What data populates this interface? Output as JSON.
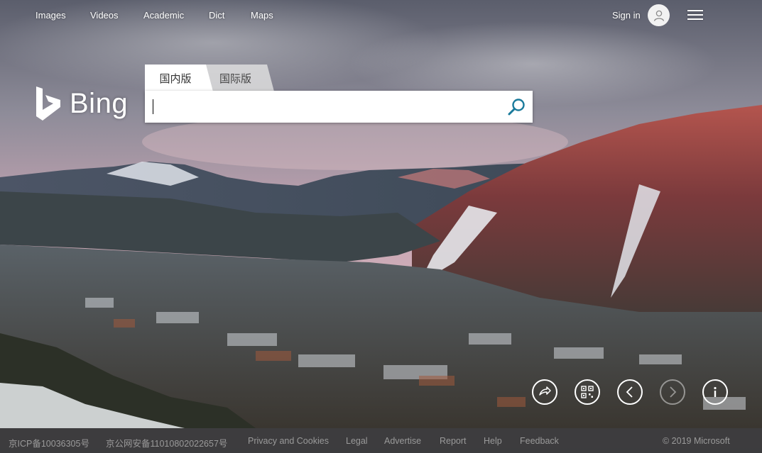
{
  "nav": {
    "links": [
      "Images",
      "Videos",
      "Academic",
      "Dict",
      "Maps"
    ],
    "sign_in": "Sign in"
  },
  "logo": {
    "text": "Bing",
    "icon": "bing-logo-icon"
  },
  "search": {
    "tabs": [
      "国内版",
      "国际版"
    ],
    "active_tab": "国内版",
    "value": "",
    "placeholder": "",
    "button_icon": "search-icon"
  },
  "actions": [
    {
      "icon": "share-icon"
    },
    {
      "icon": "qr-code-icon"
    },
    {
      "icon": "previous-image-icon"
    },
    {
      "icon": "next-image-icon",
      "disabled": true
    },
    {
      "icon": "info-icon"
    }
  ],
  "footer": {
    "links": [
      "京ICP备10036305号",
      "京公网安备11010802022657号",
      "Privacy and Cookies",
      "Legal",
      "Advertise",
      "Report",
      "Help",
      "Feedback"
    ],
    "copyright": "© 2019 Microsoft"
  },
  "colors": {
    "search_icon": "#1a7a9b",
    "footer_bg": "#2d2d2d",
    "footer_text": "#9a9a9a"
  }
}
